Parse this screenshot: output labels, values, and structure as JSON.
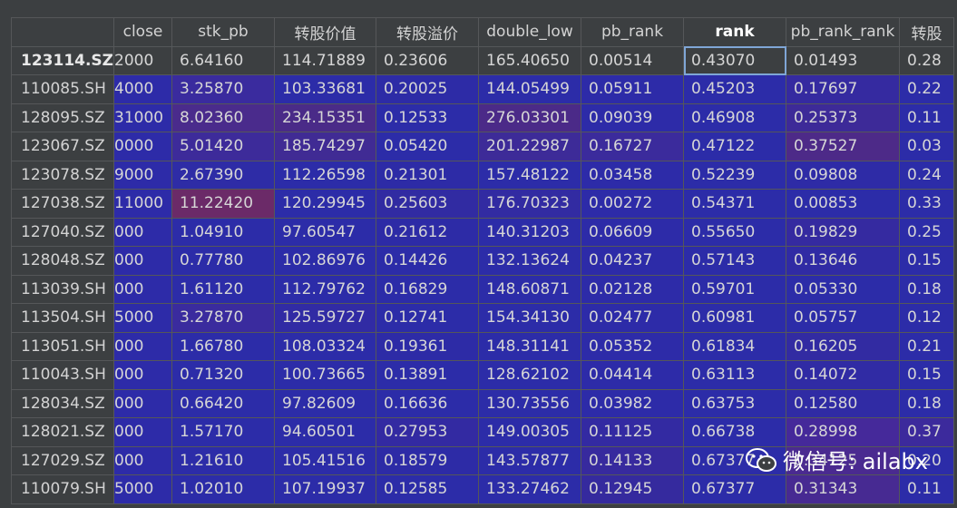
{
  "table": {
    "columns": [
      "close",
      "stk_pb",
      "转股价值",
      "转股溢价",
      "double_low",
      "pb_rank",
      "rank",
      "pb_rank_rank",
      "转股"
    ],
    "sorted_column": "rank",
    "selected_cell": {
      "row": 0,
      "column": "rank"
    },
    "rows": [
      {
        "index": "123114.SZ",
        "cells": [
          "2000",
          "6.64160",
          "114.71889",
          "0.23606",
          "165.40650",
          "0.00514",
          "0.43070",
          "0.01493",
          "0.28"
        ],
        "colors": [
          "#3c3f41",
          "#3c3f41",
          "#3c3f41",
          "#3c3f41",
          "#3c3f41",
          "#3c3f41",
          "#3c3f41",
          "#3c3f41",
          "#3c3f41"
        ]
      },
      {
        "index": "110085.SH",
        "cells": [
          "4000",
          "3.25870",
          "103.33681",
          "0.20025",
          "144.05499",
          "0.05911",
          "0.45203",
          "0.17697",
          "0.22"
        ],
        "colors": [
          "#2d2ba8",
          "#3a2b9e",
          "#2c2ca8",
          "#2d2ba6",
          "#2c2ca8",
          "#2d2ba8",
          "#2c2ca8",
          "#352aa0",
          "#2c2ca8"
        ]
      },
      {
        "index": "128095.SZ",
        "cells": [
          "31000",
          "8.02360",
          "234.15351",
          "0.12533",
          "276.03301",
          "0.09039",
          "0.46908",
          "0.25373",
          "0.11"
        ],
        "colors": [
          "#2d2ba8",
          "#4a2b8c",
          "#4a2b88",
          "#2c2ca8",
          "#4b2a88",
          "#2d2ba8",
          "#2c2ca8",
          "#3d2a98",
          "#2c2ca8"
        ]
      },
      {
        "index": "123067.SZ",
        "cells": [
          "0000",
          "5.01420",
          "185.74297",
          "0.05420",
          "201.22987",
          "0.16727",
          "0.47122",
          "0.37527",
          "0.03"
        ],
        "colors": [
          "#2d2ba8",
          "#3d2b9a",
          "#402b94",
          "#2c2ca8",
          "#3d2b98",
          "#3b2b9c",
          "#2c2ca8",
          "#4d2a88",
          "#2c2ca8"
        ]
      },
      {
        "index": "123078.SZ",
        "cells": [
          "9000",
          "2.67390",
          "112.26598",
          "0.21301",
          "157.48122",
          "0.03458",
          "0.52239",
          "0.09808",
          "0.24"
        ],
        "colors": [
          "#2d2ba8",
          "#2e2ca6",
          "#2c2ca8",
          "#2d2ba6",
          "#2c2ca8",
          "#2d2ba8",
          "#2c2ca8",
          "#2e2ba6",
          "#2c2ca8"
        ]
      },
      {
        "index": "127038.SZ",
        "cells": [
          "11000",
          "11.22420",
          "120.29945",
          "0.25603",
          "176.70323",
          "0.00272",
          "0.54371",
          "0.00853",
          "0.33"
        ],
        "colors": [
          "#2d2ba8",
          "#6b2a68",
          "#2c2ca8",
          "#312ba2",
          "#322ba2",
          "#2d2ba8",
          "#2c2ca8",
          "#2c2ca8",
          "#2c2ca8"
        ]
      },
      {
        "index": "127040.SZ",
        "cells": [
          "000",
          "1.04910",
          "97.60547",
          "0.21612",
          "140.31203",
          "0.06609",
          "0.55650",
          "0.19829",
          "0.25"
        ],
        "colors": [
          "#2d2ba8",
          "#2c2ca8",
          "#2c2ca8",
          "#2d2ba6",
          "#2c2ca8",
          "#2d2ba8",
          "#2c2ca8",
          "#352aa0",
          "#2c2ca8"
        ]
      },
      {
        "index": "128048.SZ",
        "cells": [
          "000",
          "0.77780",
          "102.86976",
          "0.14426",
          "132.13624",
          "0.04237",
          "0.57143",
          "0.13646",
          "0.15"
        ],
        "colors": [
          "#2d2ba8",
          "#2c2ca8",
          "#2c2ca8",
          "#2c2ca8",
          "#2c2ca8",
          "#2d2ba8",
          "#2c2ca8",
          "#302ba4",
          "#2c2ca8"
        ]
      },
      {
        "index": "113039.SH",
        "cells": [
          "000",
          "1.61120",
          "112.79762",
          "0.16829",
          "148.60871",
          "0.02128",
          "0.59701",
          "0.05330",
          "0.18"
        ],
        "colors": [
          "#2d2ba8",
          "#2c2ca8",
          "#2c2ca8",
          "#2c2ca8",
          "#2c2ca8",
          "#2d2ba8",
          "#2c2ca8",
          "#2c2ca8",
          "#2c2ca8"
        ]
      },
      {
        "index": "113504.SH",
        "cells": [
          "5000",
          "3.27870",
          "125.59727",
          "0.12741",
          "154.34130",
          "0.02477",
          "0.60981",
          "0.05757",
          "0.12"
        ],
        "colors": [
          "#2d2ba8",
          "#3a2b9e",
          "#312ba4",
          "#2c2ca8",
          "#2c2ca8",
          "#2d2ba8",
          "#2c2ca8",
          "#2c2ca8",
          "#2c2ca8"
        ]
      },
      {
        "index": "113051.SH",
        "cells": [
          "000",
          "1.66780",
          "108.03324",
          "0.19361",
          "148.31141",
          "0.05352",
          "0.61834",
          "0.16205",
          "0.21"
        ],
        "colors": [
          "#2d2ba8",
          "#2c2ca8",
          "#2c2ca8",
          "#2d2ba6",
          "#2c2ca8",
          "#2d2ba8",
          "#2c2ca8",
          "#322ba2",
          "#2c2ca8"
        ]
      },
      {
        "index": "110043.SH",
        "cells": [
          "000",
          "0.71320",
          "100.73665",
          "0.13891",
          "128.62102",
          "0.04414",
          "0.63113",
          "0.14072",
          "0.15"
        ],
        "colors": [
          "#2d2ba8",
          "#2c2ca8",
          "#2c2ca8",
          "#2c2ca8",
          "#2c2ca8",
          "#2d2ba8",
          "#2c2ca8",
          "#302ba4",
          "#2c2ca8"
        ]
      },
      {
        "index": "128034.SZ",
        "cells": [
          "000",
          "0.66420",
          "97.82609",
          "0.16636",
          "130.73556",
          "0.03982",
          "0.63753",
          "0.12580",
          "0.18"
        ],
        "colors": [
          "#2d2ba8",
          "#2c2ca8",
          "#2c2ca8",
          "#2c2ca8",
          "#2c2ca8",
          "#2d2ba8",
          "#2c2ca8",
          "#302ba4",
          "#2c2ca8"
        ]
      },
      {
        "index": "128021.SZ",
        "cells": [
          "000",
          "1.57170",
          "94.60501",
          "0.27953",
          "149.00305",
          "0.11125",
          "0.66738",
          "0.28998",
          "0.37"
        ],
        "colors": [
          "#2d2ba8",
          "#2c2ca8",
          "#2c2ca8",
          "#332aa2",
          "#2c2ca8",
          "#332aa2",
          "#2c2ca8",
          "#45299a",
          "#3c2a9c"
        ]
      },
      {
        "index": "127029.SZ",
        "cells": [
          "000",
          "1.21610",
          "105.41516",
          "0.18579",
          "143.57877",
          "0.14133",
          "0.67377",
          "0.34125",
          "0.20"
        ],
        "colors": [
          "#2d2ba8",
          "#2c2ca8",
          "#2c2ca8",
          "#2d2ba6",
          "#2c2ca8",
          "#372a9e",
          "#2c2ca8",
          "#4a2a90",
          "#2c2ca8"
        ]
      },
      {
        "index": "110079.SH",
        "cells": [
          "5000",
          "1.02010",
          "107.19937",
          "0.12585",
          "133.27462",
          "0.12945",
          "0.67377",
          "0.31343",
          "0.11"
        ],
        "colors": [
          "#2d2ba8",
          "#2c2ca8",
          "#2c2ca8",
          "#2c2ca8",
          "#2c2ca8",
          "#352a9e",
          "#2c2ca8",
          "#472a92",
          "#2c2ca8"
        ]
      }
    ]
  },
  "watermark": {
    "text": "微信号: ailabx",
    "icon": "wechat-icon"
  }
}
